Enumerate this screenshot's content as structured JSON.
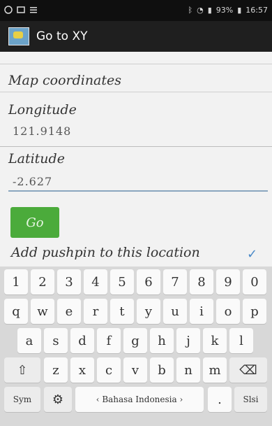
{
  "status_bar": {
    "left_icons": [
      "chat-icon",
      "image-icon",
      "menu-icon"
    ],
    "right_text": "93%",
    "time": "16:57"
  },
  "app_bar": {
    "title": "Go to XY"
  },
  "form": {
    "cutoff_text": "",
    "section_title": "Map coordinates",
    "longitude": {
      "label": "Longitude",
      "value": "121.9148"
    },
    "latitude": {
      "label": "Latitude",
      "value": "-2.627"
    }
  },
  "actions": {
    "go_label": "Go",
    "pushpin_label": "Add pushpin to this location",
    "checkmark": "✓"
  },
  "keyboard": {
    "row1": [
      "1",
      "2",
      "3",
      "4",
      "5",
      "6",
      "7",
      "8",
      "9",
      "0"
    ],
    "row2": [
      "q",
      "w",
      "e",
      "r",
      "t",
      "y",
      "u",
      "i",
      "o",
      "p"
    ],
    "row3": [
      "a",
      "s",
      "d",
      "f",
      "g",
      "h",
      "j",
      "k",
      "l"
    ],
    "row4": [
      "⇧",
      "z",
      "x",
      "c",
      "v",
      "b",
      "n",
      "m",
      "⌫"
    ],
    "row5": {
      "sym": "Sym",
      "gear": "⚙",
      "space": "‹ Bahasa Indonesia ›",
      "period": ".",
      "next": "Slsi"
    }
  },
  "colors": {
    "status_bar": "#0f0f0f",
    "app_bar": "#1f1f1f",
    "go_button": "#4bab3b",
    "checkmark": "#4a89c8"
  }
}
